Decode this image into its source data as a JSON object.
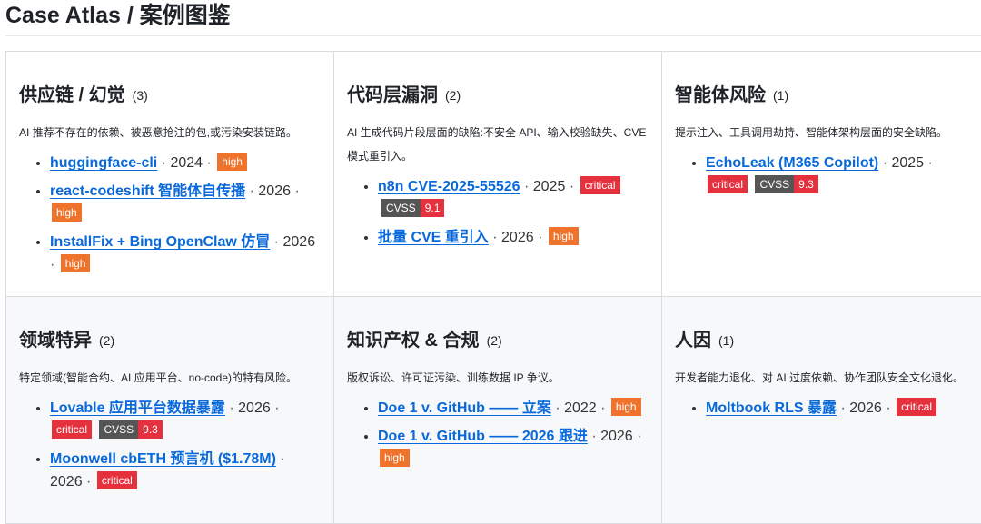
{
  "page": {
    "title": "Case Atlas / 案例图鉴"
  },
  "sep": "·",
  "categories": [
    {
      "title": "供应链 / 幻觉",
      "count": "(3)",
      "desc": "AI 推荐不存在的依赖、被恶意抢注的包,或污染安装链路。",
      "items": [
        {
          "name": "huggingface-cli",
          "year": "2024",
          "severity": "high"
        },
        {
          "name": "react-codeshift 智能体自传播",
          "year": "2026",
          "severity": "high"
        },
        {
          "name": "InstallFix + Bing OpenClaw 仿冒",
          "year": "2026",
          "severity": "high"
        }
      ]
    },
    {
      "title": "代码层漏洞",
      "count": "(2)",
      "desc": "AI 生成代码片段层面的缺陷:不安全 API、输入校验缺失、CVE 模式重引入。",
      "items": [
        {
          "name": "n8n CVE-2025-55526",
          "year": "2025",
          "severity": "critical",
          "cvss_label": "CVSS",
          "cvss": "9.1"
        },
        {
          "name": "批量 CVE 重引入",
          "year": "2026",
          "severity": "high"
        }
      ]
    },
    {
      "title": "智能体风险",
      "count": "(1)",
      "desc": "提示注入、工具调用劫持、智能体架构层面的安全缺陷。",
      "items": [
        {
          "name": "EchoLeak (M365 Copilot)",
          "year": "2025",
          "severity": "critical",
          "cvss_label": "CVSS",
          "cvss": "9.3"
        }
      ]
    },
    {
      "title": "领域特异",
      "count": "(2)",
      "desc": "特定领域(智能合约、AI 应用平台、no-code)的特有风险。",
      "items": [
        {
          "name": "Lovable 应用平台数据暴露",
          "year": "2026",
          "severity": "critical",
          "cvss_label": "CVSS",
          "cvss": "9.3"
        },
        {
          "name": "Moonwell cbETH 预言机 ($1.78M)",
          "year": "2026",
          "severity": "critical"
        }
      ]
    },
    {
      "title": "知识产权 & 合规",
      "count": "(2)",
      "desc": "版权诉讼、许可证污染、训练数据 IP 争议。",
      "items": [
        {
          "name": "Doe 1 v. GitHub —— 立案",
          "year": "2022",
          "severity": "high"
        },
        {
          "name": "Doe 1 v. GitHub —— 2026 跟进",
          "year": "2026",
          "severity": "high"
        }
      ]
    },
    {
      "title": "人因",
      "count": "(1)",
      "desc": "开发者能力退化、对 AI 过度依赖、协作团队安全文化退化。",
      "items": [
        {
          "name": "Moltbook RLS 暴露",
          "year": "2026",
          "severity": "critical"
        }
      ]
    }
  ]
}
